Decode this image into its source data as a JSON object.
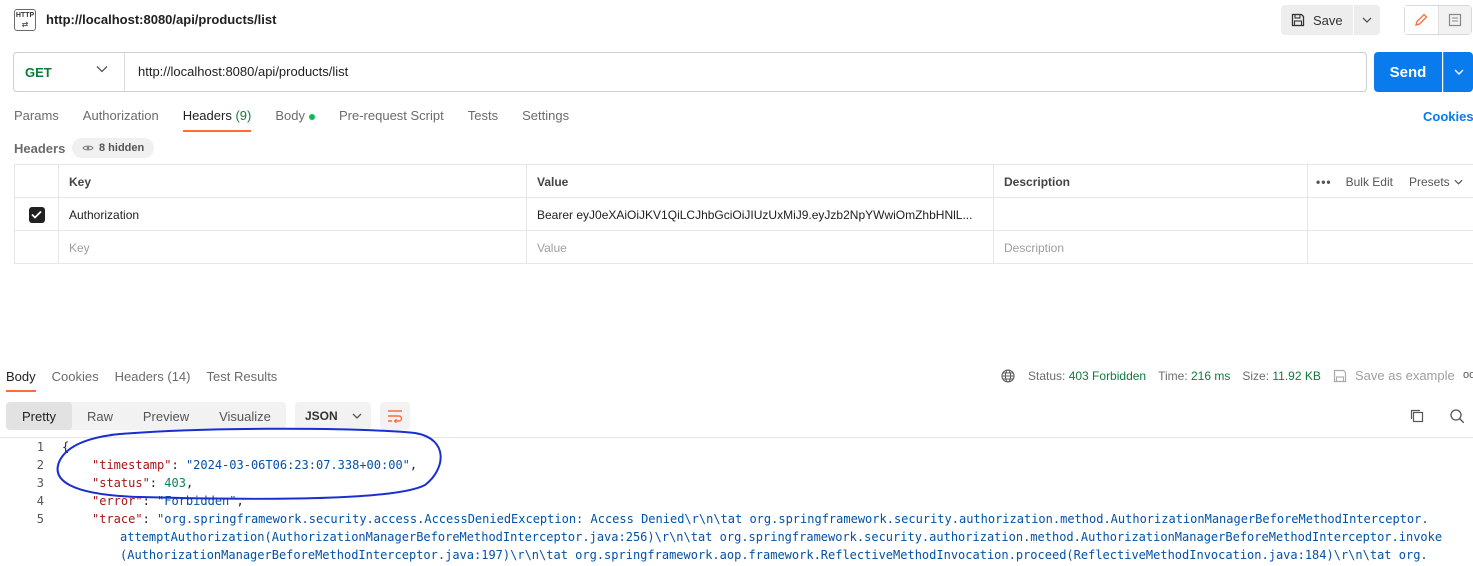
{
  "titlebar": {
    "icon_text": "HTTP",
    "request_name": "http://localhost:8080/api/products/list",
    "save_label": "Save"
  },
  "request": {
    "method": "GET",
    "url": "http://localhost:8080/api/products/list",
    "send_label": "Send"
  },
  "request_tabs": {
    "params": "Params",
    "authorization": "Authorization",
    "headers": "Headers",
    "headers_count": "(9)",
    "body": "Body",
    "pre_request": "Pre-request Script",
    "tests": "Tests",
    "settings": "Settings",
    "cookies": "Cookies"
  },
  "headers_section": {
    "label": "Headers",
    "hidden": "8 hidden",
    "columns": {
      "key": "Key",
      "value": "Value",
      "description": "Description",
      "bulk_edit": "Bulk Edit",
      "presets": "Presets"
    },
    "rows": [
      {
        "checked": true,
        "key": "Authorization",
        "value": "Bearer eyJ0eXAiOiJKV1QiLCJhbGciOiJIUzUxMiJ9.eyJzb2NpYWwiOmZhbHNlL...",
        "description": ""
      }
    ],
    "new_row": {
      "key_placeholder": "Key",
      "value_placeholder": "Value",
      "description_placeholder": "Description"
    }
  },
  "response_tabs": {
    "body": "Body",
    "cookies": "Cookies",
    "headers": "Headers",
    "headers_count": "(14)",
    "test_results": "Test Results"
  },
  "response_meta": {
    "status_label": "Status:",
    "status_value": "403 Forbidden",
    "time_label": "Time:",
    "time_value": "216 ms",
    "size_label": "Size:",
    "size_value": "11.92 KB",
    "save_example": "Save as example"
  },
  "view_modes": {
    "pretty": "Pretty",
    "raw": "Raw",
    "preview": "Preview",
    "visualize": "Visualize"
  },
  "format": "JSON",
  "body_lines": {
    "l1": "{",
    "timestamp_key": "\"timestamp\"",
    "timestamp_val": "\"2024-03-06T06:23:07.338+00:00\"",
    "status_key": "\"status\"",
    "status_val": "403",
    "error_key": "\"error\"",
    "error_val": "\"Forbidden\"",
    "trace_key": "\"trace\"",
    "trace_val_1": "\"org.springframework.security.access.AccessDeniedException: Access Denied\\r\\n\\tat org.springframework.security.authorization.method.AuthorizationManagerBeforeMethodInterceptor.",
    "trace_val_2": "attemptAuthorization(AuthorizationManagerBeforeMethodInterceptor.java:256)\\r\\n\\tat org.springframework.security.authorization.method.AuthorizationManagerBeforeMethodInterceptor.invoke",
    "trace_val_3": "(AuthorizationManagerBeforeMethodInterceptor.java:197)\\r\\n\\tat org.springframework.aop.framework.ReflectiveMethodInvocation.proceed(ReflectiveMethodInvocation.java:184)\\r\\n\\tat org.",
    "line_numbers": [
      "1",
      "2",
      "3",
      "4",
      "5"
    ]
  },
  "colors": {
    "accent": "#ff6c37",
    "send": "#097bed",
    "method_get": "#0f7b3b",
    "annotation": "#1a2fd1"
  }
}
